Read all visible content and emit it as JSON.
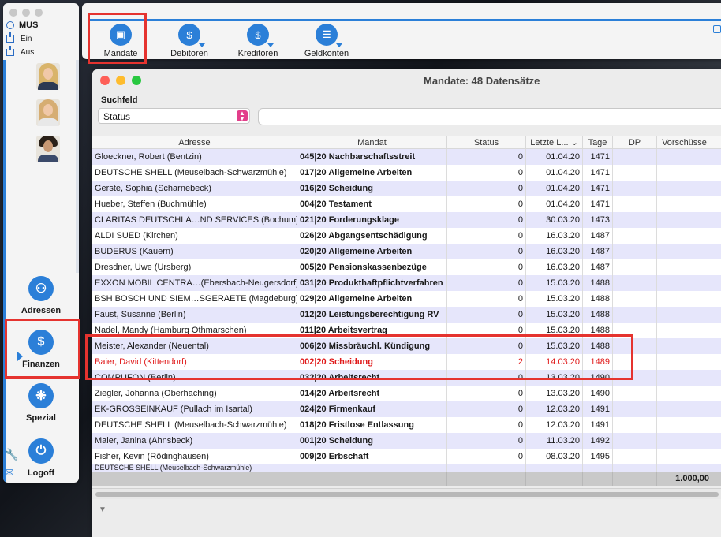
{
  "left_panel": {
    "user": "MUS",
    "ein": "Ein",
    "aus": "Aus",
    "nav": [
      {
        "label": "Adressen",
        "icon": "people-icon"
      },
      {
        "label": "Finanzen",
        "icon": "coins-icon"
      },
      {
        "label": "Spezial",
        "icon": "helm-icon"
      },
      {
        "label": "Logoff",
        "icon": "power-icon"
      }
    ]
  },
  "toolbar": {
    "items": [
      {
        "label": "Mandate",
        "icon": "folder-icon"
      },
      {
        "label": "Debitoren",
        "icon": "money-hand-icon"
      },
      {
        "label": "Kreditoren",
        "icon": "money-give-icon"
      },
      {
        "label": "Geldkonten",
        "icon": "book-icon"
      }
    ]
  },
  "window": {
    "title": "Mandate: 48 Datensätze",
    "suchfeld_label": "Suchfeld",
    "suchfeld_value": "Status",
    "search_value": ""
  },
  "table": {
    "headers": [
      "Adresse",
      "Mandat",
      "Status",
      "Letzte L...",
      "Tage",
      "DP",
      "Vorschüsse"
    ],
    "rows": [
      {
        "adresse": "Gloeckner, Robert (Bentzin)",
        "mandat": "045|20 Nachbarschaftsstreit",
        "status": "0",
        "letzte": "01.04.20",
        "tage": "1471"
      },
      {
        "adresse": "DEUTSCHE SHELL (Meuselbach-Schwarzmühle)",
        "mandat": "017|20 Allgemeine Arbeiten",
        "status": "0",
        "letzte": "01.04.20",
        "tage": "1471"
      },
      {
        "adresse": "Gerste, Sophia (Scharnebeck)",
        "mandat": "016|20 Scheidung",
        "status": "0",
        "letzte": "01.04.20",
        "tage": "1471"
      },
      {
        "adresse": "Hueber, Steffen (Buchmühle)",
        "mandat": "004|20 Testament",
        "status": "0",
        "letzte": "01.04.20",
        "tage": "1471"
      },
      {
        "adresse": "CLARITAS DEUTSCHLA…ND SERVICES (Bochum)",
        "mandat": "021|20 Forderungsklage",
        "status": "0",
        "letzte": "30.03.20",
        "tage": "1473"
      },
      {
        "adresse": "ALDI SUED (Kirchen)",
        "mandat": "026|20 Abgangsentschädigung",
        "status": "0",
        "letzte": "16.03.20",
        "tage": "1487"
      },
      {
        "adresse": "BUDERUS (Kauern)",
        "mandat": "020|20 Allgemeine Arbeiten",
        "status": "0",
        "letzte": "16.03.20",
        "tage": "1487"
      },
      {
        "adresse": "Dresdner, Uwe (Ursberg)",
        "mandat": "005|20 Pensionskassenbezüge",
        "status": "0",
        "letzte": "16.03.20",
        "tage": "1487"
      },
      {
        "adresse": "EXXON MOBIL CENTRA…(Ebersbach-Neugersdorf)",
        "mandat": "031|20 Produkthaftpflichtverfahren",
        "status": "0",
        "letzte": "15.03.20",
        "tage": "1488"
      },
      {
        "adresse": "BSH BOSCH UND SIEM…SGERAETE (Magdeburg)",
        "mandat": "029|20 Allgemeine Arbeiten",
        "status": "0",
        "letzte": "15.03.20",
        "tage": "1488"
      },
      {
        "adresse": "Faust, Susanne (Berlin)",
        "mandat": "012|20 Leistungsberechtigung RV",
        "status": "0",
        "letzte": "15.03.20",
        "tage": "1488"
      },
      {
        "adresse": "Nadel, Mandy (Hamburg Othmarschen)",
        "mandat": "011|20 Arbeitsvertrag",
        "status": "0",
        "letzte": "15.03.20",
        "tage": "1488"
      },
      {
        "adresse": "Meister, Alexander (Neuental)",
        "mandat": "006|20 Missbräuchl. Kündigung",
        "status": "0",
        "letzte": "15.03.20",
        "tage": "1488"
      },
      {
        "adresse": "Baier, David (Kittendorf)",
        "mandat": "002|20 Scheidung",
        "status": "2",
        "letzte": "14.03.20",
        "tage": "1489",
        "red": true
      },
      {
        "adresse": "COMPUFON (Berlin)",
        "mandat": "032|20 Arbeitsrecht",
        "status": "0",
        "letzte": "13.03.20",
        "tage": "1490"
      },
      {
        "adresse": "Ziegler, Johanna (Oberhaching)",
        "mandat": "014|20 Arbeitsrecht",
        "status": "0",
        "letzte": "13.03.20",
        "tage": "1490"
      },
      {
        "adresse": "EK-GROSSEINKAUF (Pullach im Isartal)",
        "mandat": "024|20 Firmenkauf",
        "status": "0",
        "letzte": "12.03.20",
        "tage": "1491"
      },
      {
        "adresse": "DEUTSCHE SHELL (Meuselbach-Schwarzmühle)",
        "mandat": "018|20 Fristlose Entlassung",
        "status": "0",
        "letzte": "12.03.20",
        "tage": "1491"
      },
      {
        "adresse": "Maier, Janina (Ahnsbeck)",
        "mandat": "001|20 Scheidung",
        "status": "0",
        "letzte": "11.03.20",
        "tage": "1492"
      },
      {
        "adresse": "Fisher, Kevin (Rödinghausen)",
        "mandat": "009|20 Erbschaft",
        "status": "0",
        "letzte": "08.03.20",
        "tage": "1495"
      }
    ],
    "footer_total": "1.000,00"
  }
}
